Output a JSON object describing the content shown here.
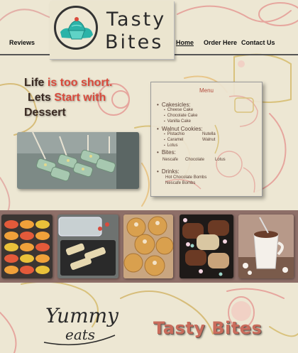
{
  "nav": {
    "reviews": "Reviews",
    "home": "Home",
    "order": "Order Here",
    "contact": "Contact Us"
  },
  "logo": {
    "line1": "Tasty",
    "line2": "Bites"
  },
  "hero": {
    "line1_a": "Life ",
    "line1_b": "is too short.",
    "line2_a": "Lets ",
    "line2_b": "Start with",
    "line3": "Dessert"
  },
  "menu": {
    "title": "Menu",
    "categories": [
      {
        "name": "Cakesicles:",
        "items": [
          "Cheese Cake",
          "Chocolate Cake",
          "Vanilla Cake"
        ]
      },
      {
        "name": "Walnut Cookies:",
        "items": [
          "Pistachio",
          "Nutella",
          "Caramel",
          "Walnut",
          "Lotus"
        ]
      },
      {
        "name": "Bites:",
        "items": [
          "Nescafe",
          "Chocolate",
          "Lotus"
        ]
      },
      {
        "name": "Drinks:",
        "items": [
          "Hot Chocolate Bombs",
          "Nescafe Bombs"
        ]
      }
    ]
  },
  "footer": {
    "yummy_line1": "Yummy",
    "yummy_line2": "eats",
    "brand": "Tasty Bites"
  },
  "colors": {
    "background": "#ede7d3",
    "accent_red": "#d94b3d",
    "menu_title": "#b24a3c",
    "gallery_band": "#8e6f68",
    "logo_teal": "#2bb3a8"
  },
  "icons": [
    "cupcake-icon"
  ]
}
